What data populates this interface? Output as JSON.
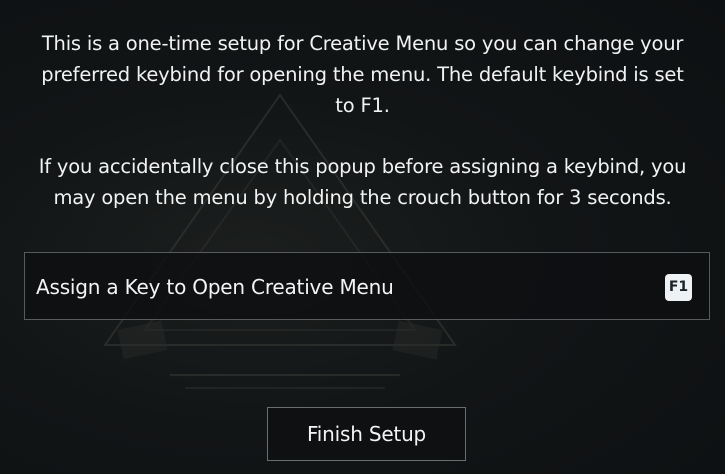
{
  "popup": {
    "intro_paragraph_1_lines": [
      "This is a one-time setup for Creative Menu so you can change your",
      "preferred keybind for opening the menu. The default keybind is set",
      "to F1."
    ],
    "intro_paragraph_2_lines": [
      "If you accidentally close this popup before assigning a keybind, you",
      "may open the menu by holding the crouch button for 3 seconds."
    ]
  },
  "keybind": {
    "label": "Assign a Key to Open Creative Menu",
    "current_key": "F1"
  },
  "actions": {
    "finish_label": "Finish Setup"
  },
  "colors": {
    "background": "#121516",
    "row_border": "#575b5e",
    "key_cap_bg": "#eef2f5",
    "key_cap_text": "#1d2228",
    "text": "#f2f2f2"
  }
}
